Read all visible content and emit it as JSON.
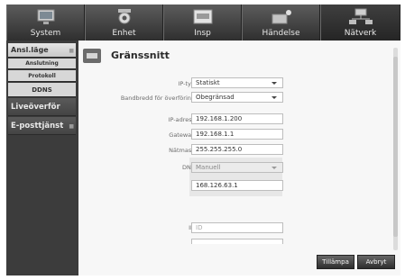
{
  "topnav": {
    "tabs": [
      {
        "label": "System",
        "icon": "monitor-icon"
      },
      {
        "label": "Enhet",
        "icon": "camera-icon"
      },
      {
        "label": "Insp",
        "icon": "recording-icon"
      },
      {
        "label": "Händelse",
        "icon": "event-icon"
      },
      {
        "label": "Nätverk",
        "icon": "network-icon",
        "active": true
      }
    ]
  },
  "sidebar": {
    "items": [
      {
        "label": "Ansl.läge",
        "style": "light"
      },
      {
        "label": "Anslutning",
        "style": "sub"
      },
      {
        "label": "Protokoll",
        "style": "sub"
      },
      {
        "label": "DDNS",
        "style": "sub"
      },
      {
        "label": "Liveöverför",
        "style": "dark"
      },
      {
        "label": "E-posttjänst",
        "style": "dark"
      }
    ]
  },
  "content": {
    "title": "Gränssnitt",
    "fields": {
      "ip_type_label": "IP-typ",
      "ip_type_value": "Statiskt",
      "bandwidth_label": "Bandbredd för överföring",
      "bandwidth_value": "Obegränsad",
      "ip_label": "IP-adress",
      "ip_value": "192.168.1.200",
      "gateway_label": "Gateway",
      "gateway_value": "192.168.1.1",
      "netmask_label": "Nätmask",
      "netmask_value": "255.255.255.0",
      "dns_label": "DNS",
      "dns_mode_value": "Manuell",
      "dns_value": "168.126.63.1",
      "id_label": "ID",
      "id_placeholder": "ID"
    },
    "buttons": {
      "apply": "Tillämpa",
      "cancel": "Avbryt"
    }
  }
}
